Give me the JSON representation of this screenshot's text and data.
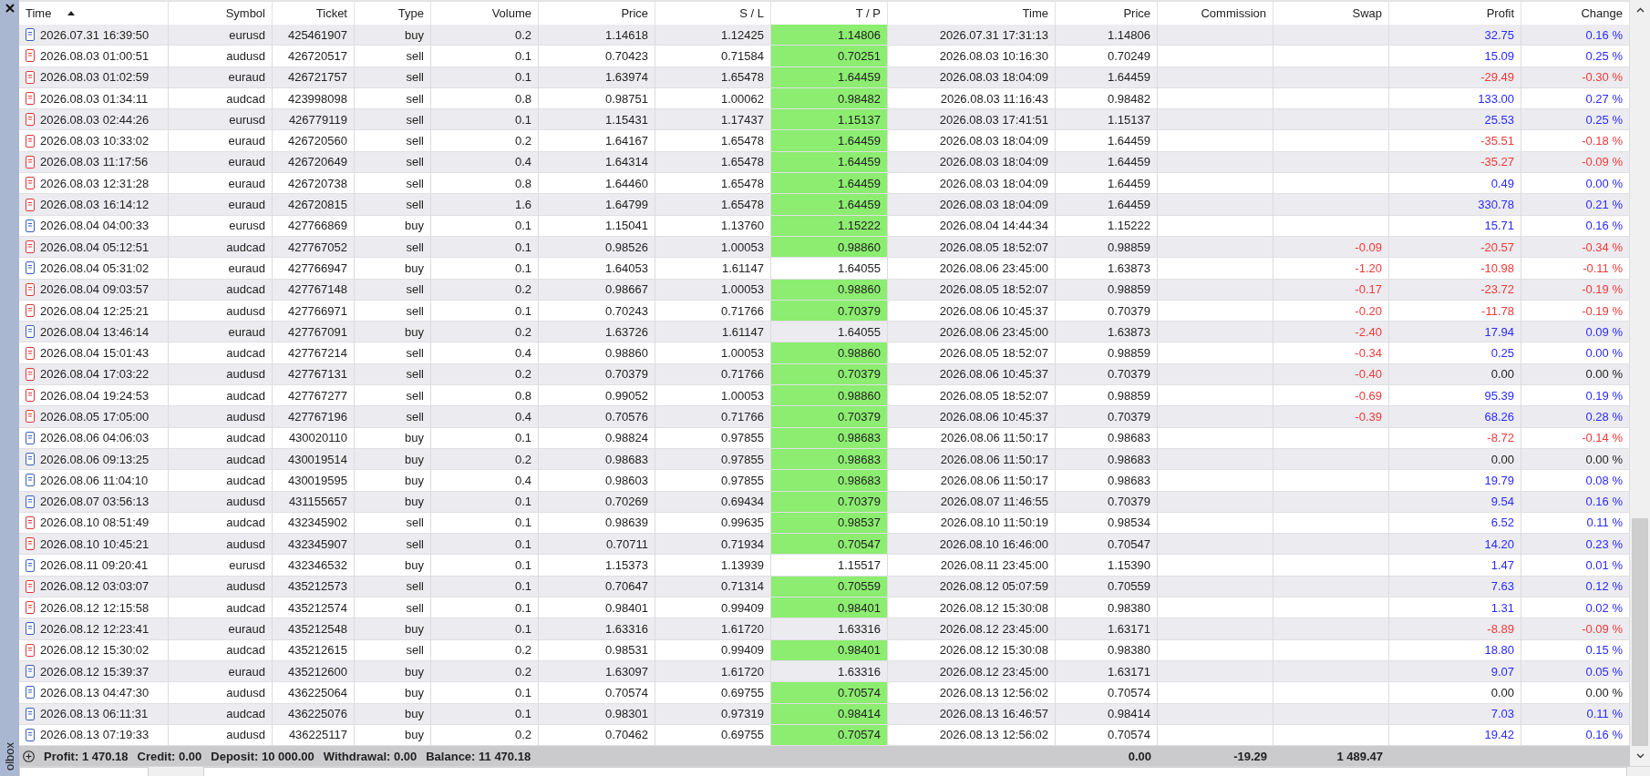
{
  "toolbox": {
    "label": "olbox"
  },
  "columns": [
    {
      "label": "Time",
      "sorted": true
    },
    {
      "label": "Symbol",
      "sorted": false
    },
    {
      "label": "Ticket",
      "sorted": false
    },
    {
      "label": "Type",
      "sorted": false
    },
    {
      "label": "Volume",
      "sorted": false
    },
    {
      "label": "Price",
      "sorted": false
    },
    {
      "label": "S / L",
      "sorted": false
    },
    {
      "label": "T / P",
      "sorted": false
    },
    {
      "label": "Time",
      "sorted": false
    },
    {
      "label": "Price",
      "sorted": false
    },
    {
      "label": "Commission",
      "sorted": false
    },
    {
      "label": "Swap",
      "sorted": false
    },
    {
      "label": "Profit",
      "sorted": false
    },
    {
      "label": "Change",
      "sorted": false
    }
  ],
  "rows": [
    {
      "kind": "buy",
      "time": "2026.07.31 16:39:50",
      "symbol": "eurusd",
      "ticket": "425461907",
      "type": "buy",
      "volume": "0.2",
      "price": "1.14618",
      "sl": "1.12425",
      "tp": "1.14806",
      "tp_hit": true,
      "close_time": "2026.07.31 17:31:13",
      "close_price": "1.14806",
      "profit": "32.75",
      "change": "0.16 %",
      "gain": true,
      "loss": false
    },
    {
      "kind": "sell",
      "time": "2026.08.03 01:00:51",
      "symbol": "audusd",
      "ticket": "426720517",
      "type": "sell",
      "volume": "0.1",
      "price": "0.70423",
      "sl": "0.71584",
      "tp": "0.70251",
      "tp_hit": true,
      "close_time": "2026.08.03 10:16:30",
      "close_price": "0.70249",
      "profit": "15.09",
      "change": "0.25 %",
      "gain": true,
      "loss": false
    },
    {
      "kind": "sell",
      "time": "2026.08.03 01:02:59",
      "symbol": "euraud",
      "ticket": "426721757",
      "type": "sell",
      "volume": "0.1",
      "price": "1.63974",
      "sl": "1.65478",
      "tp": "1.64459",
      "tp_hit": true,
      "close_time": "2026.08.03 18:04:09",
      "close_price": "1.64459",
      "profit": "-29.49",
      "change": "-0.30 %",
      "gain": false,
      "loss": true
    },
    {
      "kind": "sell",
      "time": "2026.08.03 01:34:11",
      "symbol": "audcad",
      "ticket": "423998098",
      "type": "sell",
      "volume": "0.8",
      "price": "0.98751",
      "sl": "1.00062",
      "tp": "0.98482",
      "tp_hit": true,
      "close_time": "2026.08.03 11:16:43",
      "close_price": "0.98482",
      "profit": "133.00",
      "change": "0.27 %",
      "gain": true,
      "loss": false
    },
    {
      "kind": "sell",
      "time": "2026.08.03 02:44:26",
      "symbol": "eurusd",
      "ticket": "426779119",
      "type": "sell",
      "volume": "0.1",
      "price": "1.15431",
      "sl": "1.17437",
      "tp": "1.15137",
      "tp_hit": true,
      "close_time": "2026.08.03 17:41:51",
      "close_price": "1.15137",
      "profit": "25.53",
      "change": "0.25 %",
      "gain": true,
      "loss": false
    },
    {
      "kind": "sell",
      "time": "2026.08.03 10:33:02",
      "symbol": "euraud",
      "ticket": "426720560",
      "type": "sell",
      "volume": "0.2",
      "price": "1.64167",
      "sl": "1.65478",
      "tp": "1.64459",
      "tp_hit": true,
      "close_time": "2026.08.03 18:04:09",
      "close_price": "1.64459",
      "profit": "-35.51",
      "change": "-0.18 %",
      "gain": false,
      "loss": true
    },
    {
      "kind": "sell",
      "time": "2026.08.03 11:17:56",
      "symbol": "euraud",
      "ticket": "426720649",
      "type": "sell",
      "volume": "0.4",
      "price": "1.64314",
      "sl": "1.65478",
      "tp": "1.64459",
      "tp_hit": true,
      "close_time": "2026.08.03 18:04:09",
      "close_price": "1.64459",
      "profit": "-35.27",
      "change": "-0.09 %",
      "gain": false,
      "loss": true
    },
    {
      "kind": "sell",
      "time": "2026.08.03 12:31:28",
      "symbol": "euraud",
      "ticket": "426720738",
      "type": "sell",
      "volume": "0.8",
      "price": "1.64460",
      "sl": "1.65478",
      "tp": "1.64459",
      "tp_hit": true,
      "close_time": "2026.08.03 18:04:09",
      "close_price": "1.64459",
      "profit": "0.49",
      "change": "0.00 %",
      "gain": true,
      "loss": false
    },
    {
      "kind": "sell",
      "time": "2026.08.03 16:14:12",
      "symbol": "euraud",
      "ticket": "426720815",
      "type": "sell",
      "volume": "1.6",
      "price": "1.64799",
      "sl": "1.65478",
      "tp": "1.64459",
      "tp_hit": true,
      "close_time": "2026.08.03 18:04:09",
      "close_price": "1.64459",
      "profit": "330.78",
      "change": "0.21 %",
      "gain": true,
      "loss": false
    },
    {
      "kind": "buy",
      "time": "2026.08.04 04:00:33",
      "symbol": "eurusd",
      "ticket": "427766869",
      "type": "buy",
      "volume": "0.1",
      "price": "1.15041",
      "sl": "1.13760",
      "tp": "1.15222",
      "tp_hit": true,
      "close_time": "2026.08.04 14:44:34",
      "close_price": "1.15222",
      "profit": "15.71",
      "change": "0.16 %",
      "gain": true,
      "loss": false
    },
    {
      "kind": "sell",
      "time": "2026.08.04 05:12:51",
      "symbol": "audcad",
      "ticket": "427767052",
      "type": "sell",
      "volume": "0.1",
      "price": "0.98526",
      "sl": "1.00053",
      "tp": "0.98860",
      "tp_hit": true,
      "close_time": "2026.08.05 18:52:07",
      "close_price": "0.98859",
      "swap": "-0.09",
      "swap_loss": true,
      "profit": "-20.57",
      "change": "-0.34 %",
      "gain": false,
      "loss": true
    },
    {
      "kind": "buy",
      "time": "2026.08.04 05:31:02",
      "symbol": "euraud",
      "ticket": "427766947",
      "type": "buy",
      "volume": "0.1",
      "price": "1.64053",
      "sl": "1.61147",
      "tp": "1.64055",
      "tp_hit": false,
      "close_time": "2026.08.06 23:45:00",
      "close_price": "1.63873",
      "swap": "-1.20",
      "swap_loss": true,
      "profit": "-10.98",
      "change": "-0.11 %",
      "gain": false,
      "loss": true
    },
    {
      "kind": "sell",
      "time": "2026.08.04 09:03:57",
      "symbol": "audcad",
      "ticket": "427767148",
      "type": "sell",
      "volume": "0.2",
      "price": "0.98667",
      "sl": "1.00053",
      "tp": "0.98860",
      "tp_hit": true,
      "close_time": "2026.08.05 18:52:07",
      "close_price": "0.98859",
      "swap": "-0.17",
      "swap_loss": true,
      "profit": "-23.72",
      "change": "-0.19 %",
      "gain": false,
      "loss": true
    },
    {
      "kind": "sell",
      "time": "2026.08.04 12:25:21",
      "symbol": "audusd",
      "ticket": "427766971",
      "type": "sell",
      "volume": "0.1",
      "price": "0.70243",
      "sl": "0.71766",
      "tp": "0.70379",
      "tp_hit": true,
      "close_time": "2026.08.06 10:45:37",
      "close_price": "0.70379",
      "swap": "-0.20",
      "swap_loss": true,
      "profit": "-11.78",
      "change": "-0.19 %",
      "gain": false,
      "loss": true
    },
    {
      "kind": "buy",
      "time": "2026.08.04 13:46:14",
      "symbol": "euraud",
      "ticket": "427767091",
      "type": "buy",
      "volume": "0.2",
      "price": "1.63726",
      "sl": "1.61147",
      "tp": "1.64055",
      "tp_hit": false,
      "close_time": "2026.08.06 23:45:00",
      "close_price": "1.63873",
      "swap": "-2.40",
      "swap_loss": true,
      "profit": "17.94",
      "change": "0.09 %",
      "gain": true,
      "loss": false
    },
    {
      "kind": "sell",
      "time": "2026.08.04 15:01:43",
      "symbol": "audcad",
      "ticket": "427767214",
      "type": "sell",
      "volume": "0.4",
      "price": "0.98860",
      "sl": "1.00053",
      "tp": "0.98860",
      "tp_hit": true,
      "close_time": "2026.08.05 18:52:07",
      "close_price": "0.98859",
      "swap": "-0.34",
      "swap_loss": true,
      "profit": "0.25",
      "change": "0.00 %",
      "gain": true,
      "loss": false
    },
    {
      "kind": "sell",
      "time": "2026.08.04 17:03:22",
      "symbol": "audusd",
      "ticket": "427767131",
      "type": "sell",
      "volume": "0.2",
      "price": "0.70379",
      "sl": "0.71766",
      "tp": "0.70379",
      "tp_hit": true,
      "close_time": "2026.08.06 10:45:37",
      "close_price": "0.70379",
      "swap": "-0.40",
      "swap_loss": true,
      "profit": "0.00",
      "change": "0.00 %",
      "gain": false,
      "loss": false
    },
    {
      "kind": "sell",
      "time": "2026.08.04 19:24:53",
      "symbol": "audcad",
      "ticket": "427767277",
      "type": "sell",
      "volume": "0.8",
      "price": "0.99052",
      "sl": "1.00053",
      "tp": "0.98860",
      "tp_hit": true,
      "close_time": "2026.08.05 18:52:07",
      "close_price": "0.98859",
      "swap": "-0.69",
      "swap_loss": true,
      "profit": "95.39",
      "change": "0.19 %",
      "gain": true,
      "loss": false
    },
    {
      "kind": "sell",
      "time": "2026.08.05 17:05:00",
      "symbol": "audusd",
      "ticket": "427767196",
      "type": "sell",
      "volume": "0.4",
      "price": "0.70576",
      "sl": "0.71766",
      "tp": "0.70379",
      "tp_hit": true,
      "close_time": "2026.08.06 10:45:37",
      "close_price": "0.70379",
      "swap": "-0.39",
      "swap_loss": true,
      "profit": "68.26",
      "change": "0.28 %",
      "gain": true,
      "loss": false
    },
    {
      "kind": "buy",
      "time": "2026.08.06 04:06:03",
      "symbol": "audcad",
      "ticket": "430020110",
      "type": "buy",
      "volume": "0.1",
      "price": "0.98824",
      "sl": "0.97855",
      "tp": "0.98683",
      "tp_hit": true,
      "close_time": "2026.08.06 11:50:17",
      "close_price": "0.98683",
      "profit": "-8.72",
      "change": "-0.14 %",
      "gain": false,
      "loss": true
    },
    {
      "kind": "buy",
      "time": "2026.08.06 09:13:25",
      "symbol": "audcad",
      "ticket": "430019514",
      "type": "buy",
      "volume": "0.2",
      "price": "0.98683",
      "sl": "0.97855",
      "tp": "0.98683",
      "tp_hit": true,
      "close_time": "2026.08.06 11:50:17",
      "close_price": "0.98683",
      "profit": "0.00",
      "change": "0.00 %",
      "gain": false,
      "loss": false
    },
    {
      "kind": "buy",
      "time": "2026.08.06 11:04:10",
      "symbol": "audcad",
      "ticket": "430019595",
      "type": "buy",
      "volume": "0.4",
      "price": "0.98603",
      "sl": "0.97855",
      "tp": "0.98683",
      "tp_hit": true,
      "close_time": "2026.08.06 11:50:17",
      "close_price": "0.98683",
      "profit": "19.79",
      "change": "0.08 %",
      "gain": true,
      "loss": false
    },
    {
      "kind": "buy",
      "time": "2026.08.07 03:56:13",
      "symbol": "audusd",
      "ticket": "431155657",
      "type": "buy",
      "volume": "0.1",
      "price": "0.70269",
      "sl": "0.69434",
      "tp": "0.70379",
      "tp_hit": true,
      "close_time": "2026.08.07 11:46:55",
      "close_price": "0.70379",
      "profit": "9.54",
      "change": "0.16 %",
      "gain": true,
      "loss": false
    },
    {
      "kind": "sell",
      "time": "2026.08.10 08:51:49",
      "symbol": "audcad",
      "ticket": "432345902",
      "type": "sell",
      "volume": "0.1",
      "price": "0.98639",
      "sl": "0.99635",
      "tp": "0.98537",
      "tp_hit": true,
      "close_time": "2026.08.10 11:50:19",
      "close_price": "0.98534",
      "profit": "6.52",
      "change": "0.11 %",
      "gain": true,
      "loss": false
    },
    {
      "kind": "sell",
      "time": "2026.08.10 10:45:21",
      "symbol": "audusd",
      "ticket": "432345907",
      "type": "sell",
      "volume": "0.1",
      "price": "0.70711",
      "sl": "0.71934",
      "tp": "0.70547",
      "tp_hit": true,
      "close_time": "2026.08.10 16:46:00",
      "close_price": "0.70547",
      "profit": "14.20",
      "change": "0.23 %",
      "gain": true,
      "loss": false
    },
    {
      "kind": "buy",
      "time": "2026.08.11 09:20:41",
      "symbol": "eurusd",
      "ticket": "432346532",
      "type": "buy",
      "volume": "0.1",
      "price": "1.15373",
      "sl": "1.13939",
      "tp": "1.15517",
      "tp_hit": false,
      "close_time": "2026.08.11 23:45:00",
      "close_price": "1.15390",
      "profit": "1.47",
      "change": "0.01 %",
      "gain": true,
      "loss": false
    },
    {
      "kind": "sell",
      "time": "2026.08.12 03:03:07",
      "symbol": "audusd",
      "ticket": "435212573",
      "type": "sell",
      "volume": "0.1",
      "price": "0.70647",
      "sl": "0.71314",
      "tp": "0.70559",
      "tp_hit": true,
      "close_time": "2026.08.12 05:07:59",
      "close_price": "0.70559",
      "profit": "7.63",
      "change": "0.12 %",
      "gain": true,
      "loss": false
    },
    {
      "kind": "sell",
      "time": "2026.08.12 12:15:58",
      "symbol": "audcad",
      "ticket": "435212574",
      "type": "sell",
      "volume": "0.1",
      "price": "0.98401",
      "sl": "0.99409",
      "tp": "0.98401",
      "tp_hit": true,
      "close_time": "2026.08.12 15:30:08",
      "close_price": "0.98380",
      "profit": "1.31",
      "change": "0.02 %",
      "gain": true,
      "loss": false
    },
    {
      "kind": "buy",
      "time": "2026.08.12 12:23:41",
      "symbol": "euraud",
      "ticket": "435212548",
      "type": "buy",
      "volume": "0.1",
      "price": "1.63316",
      "sl": "1.61720",
      "tp": "1.63316",
      "tp_hit": false,
      "close_time": "2026.08.12 23:45:00",
      "close_price": "1.63171",
      "profit": "-8.89",
      "change": "-0.09 %",
      "gain": false,
      "loss": true
    },
    {
      "kind": "sell",
      "time": "2026.08.12 15:30:02",
      "symbol": "audcad",
      "ticket": "435212615",
      "type": "sell",
      "volume": "0.2",
      "price": "0.98531",
      "sl": "0.99409",
      "tp": "0.98401",
      "tp_hit": true,
      "close_time": "2026.08.12 15:30:08",
      "close_price": "0.98380",
      "profit": "18.80",
      "change": "0.15 %",
      "gain": true,
      "loss": false
    },
    {
      "kind": "buy",
      "time": "2026.08.12 15:39:37",
      "symbol": "euraud",
      "ticket": "435212600",
      "type": "buy",
      "volume": "0.2",
      "price": "1.63097",
      "sl": "1.61720",
      "tp": "1.63316",
      "tp_hit": false,
      "close_time": "2026.08.12 23:45:00",
      "close_price": "1.63171",
      "profit": "9.07",
      "change": "0.05 %",
      "gain": true,
      "loss": false
    },
    {
      "kind": "buy",
      "time": "2026.08.13 04:47:30",
      "symbol": "audusd",
      "ticket": "436225064",
      "type": "buy",
      "volume": "0.1",
      "price": "0.70574",
      "sl": "0.69755",
      "tp": "0.70574",
      "tp_hit": true,
      "close_time": "2026.08.13 12:56:02",
      "close_price": "0.70574",
      "profit": "0.00",
      "change": "0.00 %",
      "gain": false,
      "loss": false
    },
    {
      "kind": "buy",
      "time": "2026.08.13 06:11:31",
      "symbol": "audcad",
      "ticket": "436225076",
      "type": "buy",
      "volume": "0.1",
      "price": "0.98301",
      "sl": "0.97319",
      "tp": "0.98414",
      "tp_hit": true,
      "close_time": "2026.08.13 16:46:57",
      "close_price": "0.98414",
      "profit": "7.03",
      "change": "0.11 %",
      "gain": true,
      "loss": false
    },
    {
      "kind": "buy",
      "time": "2026.08.13 07:19:33",
      "symbol": "audusd",
      "ticket": "436225117",
      "type": "buy",
      "volume": "0.2",
      "price": "0.70462",
      "sl": "0.69755",
      "tp": "0.70574",
      "tp_hit": true,
      "close_time": "2026.08.13 12:56:02",
      "close_price": "0.70574",
      "profit": "19.42",
      "change": "0.16 %",
      "gain": true,
      "loss": false
    }
  ],
  "summary": {
    "items": [
      "Profit: 1 470.18",
      "Credit: 0.00",
      "Deposit: 10 000.00",
      "Withdrawal: 0.00",
      "Balance: 11 470.18"
    ],
    "commission": "0.00",
    "swap": "-19.29",
    "profit": "1 489.47"
  }
}
